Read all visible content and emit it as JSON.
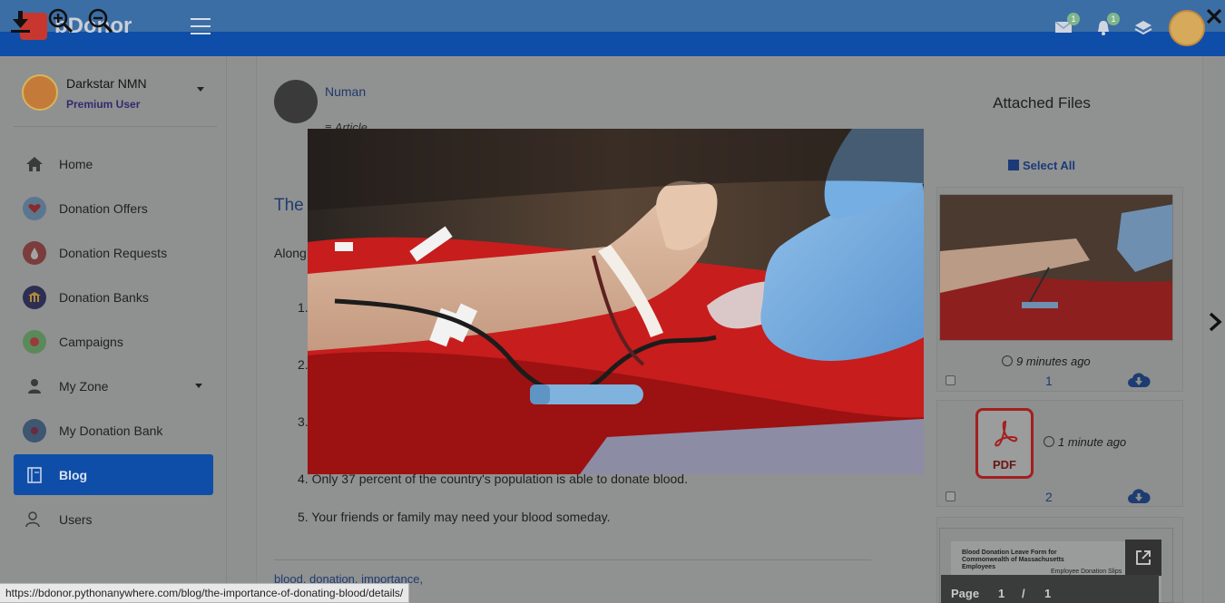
{
  "navbar": {
    "brand": "bDonor",
    "mail_badge": "1",
    "notification_badge": "1"
  },
  "sidebar": {
    "user": {
      "name": "Darkstar NMN",
      "role": "Premium User"
    },
    "items": [
      {
        "label": "Home",
        "icon": "home-icon"
      },
      {
        "label": "Donation Offers",
        "icon": "donation-offers-icon"
      },
      {
        "label": "Donation Requests",
        "icon": "donation-requests-icon"
      },
      {
        "label": "Donation Banks",
        "icon": "donation-banks-icon"
      },
      {
        "label": "Campaigns",
        "icon": "campaigns-icon"
      },
      {
        "label": "My Zone",
        "icon": "person-icon"
      },
      {
        "label": "My Donation Bank",
        "icon": "my-donation-bank-icon"
      },
      {
        "label": "Blog",
        "icon": "book-icon"
      },
      {
        "label": "Users",
        "icon": "users-icon"
      }
    ],
    "active_item": "Blog"
  },
  "article": {
    "author": "Numan",
    "category": "Article",
    "title_visible": "The",
    "intro_visible": "Along",
    "list_numbers_visible": [
      "1.",
      "2.",
      "3."
    ],
    "list_items_visible": [
      "4. Only 37 percent of the country's population is able to donate blood.",
      "5. Your friends or family may need your blood someday."
    ],
    "tags": "blood, donation, importance,"
  },
  "attached_files": {
    "title": "Attached Files",
    "select_all": "Select All",
    "files": [
      {
        "time": "9 minutes ago",
        "number": "1",
        "type": "image"
      },
      {
        "time": "1 minute ago",
        "number": "2",
        "type": "pdf",
        "icon_label": "PDF"
      }
    ],
    "document_preview": {
      "title": "Blood Donation Leave Form for Commonwealth of Massachusetts Employees",
      "subtitle": "Employee Donation Slips"
    },
    "pager": {
      "label": "Page",
      "current": "1",
      "separator": "/",
      "total": "1"
    }
  },
  "lightbox": {
    "toolbar": [
      "download-icon",
      "zoom-in-icon",
      "zoom-out-icon"
    ],
    "close": "close-icon",
    "next": "chevron-right-icon"
  },
  "status_url": "https://bdonor.pythonanywhere.com/blog/the-importance-of-donating-blood/details/",
  "colors": {
    "navbar": "#0f4ea8",
    "active_menu": "#0f4ea8",
    "overlay_dim": "#8f9090",
    "accent_link": "#1b3a78"
  }
}
